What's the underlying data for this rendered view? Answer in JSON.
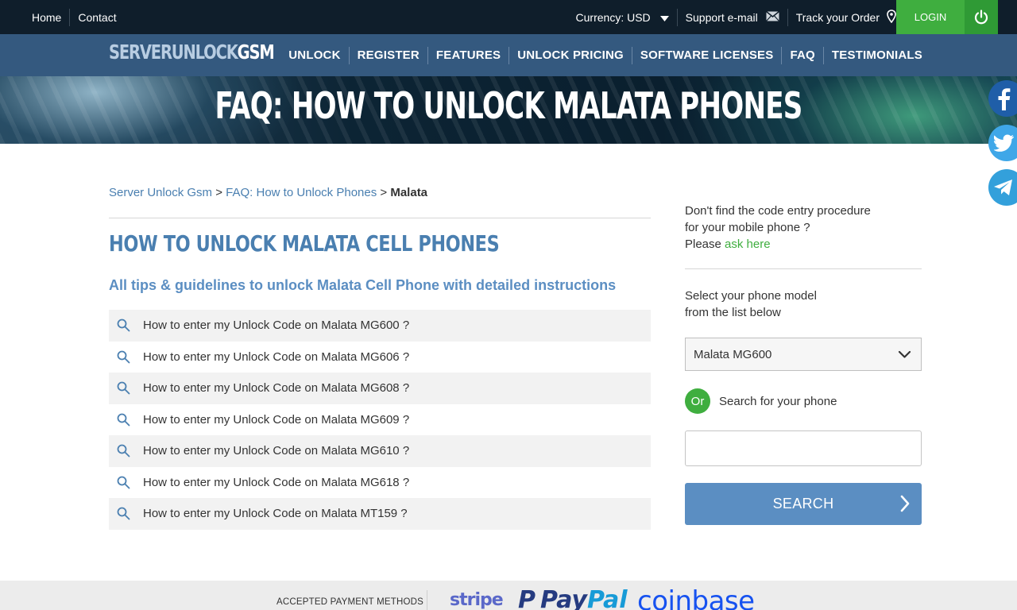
{
  "topbar": {
    "home": "Home",
    "contact": "Contact",
    "currency": "Currency: USD",
    "support": "Support e-mail",
    "track": "Track your Order",
    "login": "LOGIN"
  },
  "logo": {
    "part1": "SERVERUNLOCK",
    "part2": "GSM"
  },
  "nav": [
    "UNLOCK",
    "REGISTER",
    "FEATURES",
    "UNLOCK PRICING",
    "SOFTWARE LICENSES",
    "FAQ",
    "TESTIMONIALS"
  ],
  "hero": {
    "title": "FAQ: HOW TO UNLOCK MALATA PHONES"
  },
  "breadcrumb": {
    "home": "Server Unlock Gsm",
    "sep": ">",
    "parent": "FAQ: How to Unlock Phones",
    "current": "Malata"
  },
  "main": {
    "title": "HOW TO UNLOCK MALATA CELL PHONES",
    "subtitle": "All tips & guidelines to unlock Malata Cell Phone with detailed instructions",
    "faqs": [
      "How to enter my Unlock Code on Malata MG600 ?",
      "How to enter my Unlock Code on Malata MG606 ?",
      "How to enter my Unlock Code on Malata MG608 ?",
      "How to enter my Unlock Code on Malata MG609 ?",
      "How to enter my Unlock Code on Malata MG610 ?",
      "How to enter my Unlock Code on Malata MG618 ?",
      "How to enter my Unlock Code on Malata MT159 ?"
    ]
  },
  "sidebar": {
    "question_line1": "Don't find the code entry procedure",
    "question_line2": "for your mobile phone ?",
    "please": "Please",
    "ask": "ask here",
    "select_line1": "Select your phone model",
    "select_line2": "from the list below",
    "selected_model": "Malata MG600",
    "or": "Or",
    "search_label": "Search for your phone",
    "search_value": "",
    "search_button": "SEARCH"
  },
  "footer": {
    "label": "ACCEPTED PAYMENT METHODS",
    "stripe": "stripe",
    "paypal_1": "Pay",
    "paypal_2": "Pal",
    "coinbase": "coinbase"
  },
  "colors": {
    "accent": "#3fae3f",
    "brand": "#34597f",
    "link": "#4a7fb0",
    "topbar": "#0f1e2b"
  }
}
